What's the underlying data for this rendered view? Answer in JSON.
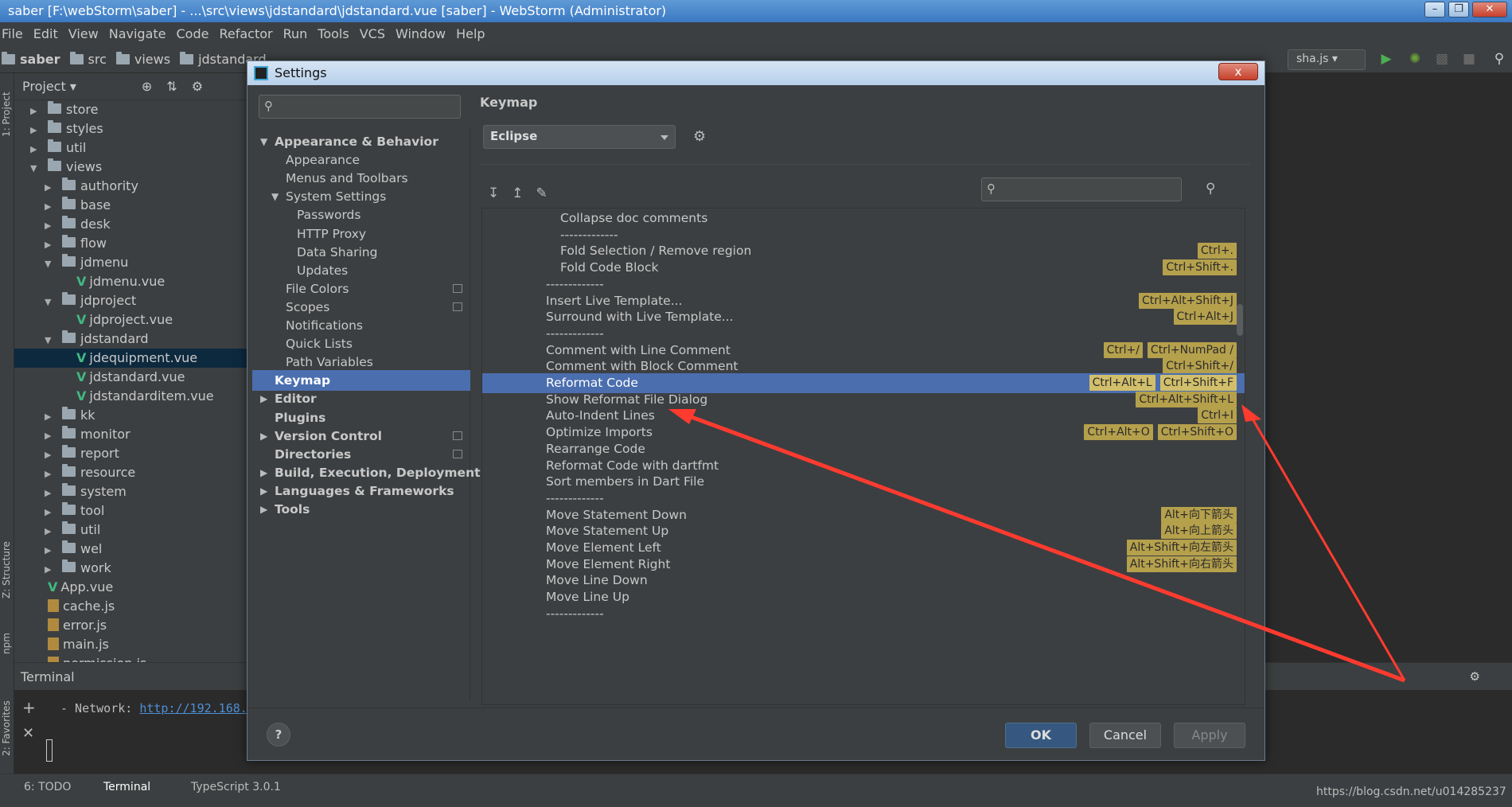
{
  "window": {
    "title": "saber [F:\\webStorm\\saber] - ...\\src\\views\\jdstandard\\jdstandard.vue [saber] - WebStorm (Administrator)"
  },
  "menu": [
    "File",
    "Edit",
    "View",
    "Navigate",
    "Code",
    "Refactor",
    "Run",
    "Tools",
    "VCS",
    "Window",
    "Help"
  ],
  "breadcrumbs": [
    "saber",
    "src",
    "views",
    "jdstandard"
  ],
  "run_config": "sha.js",
  "project": {
    "title": "Project",
    "tree": [
      {
        "label": "store",
        "type": "folder",
        "depth": 1,
        "collapsed": true
      },
      {
        "label": "styles",
        "type": "folder",
        "depth": 1,
        "collapsed": true
      },
      {
        "label": "util",
        "type": "folder",
        "depth": 1,
        "collapsed": true
      },
      {
        "label": "views",
        "type": "folder",
        "depth": 1,
        "collapsed": false
      },
      {
        "label": "authority",
        "type": "folder",
        "depth": 2,
        "collapsed": true
      },
      {
        "label": "base",
        "type": "folder",
        "depth": 2,
        "collapsed": true
      },
      {
        "label": "desk",
        "type": "folder",
        "depth": 2,
        "collapsed": true
      },
      {
        "label": "flow",
        "type": "folder",
        "depth": 2,
        "collapsed": true
      },
      {
        "label": "jdmenu",
        "type": "folder",
        "depth": 2,
        "collapsed": false
      },
      {
        "label": "jdmenu.vue",
        "type": "vue",
        "depth": 3
      },
      {
        "label": "jdproject",
        "type": "folder",
        "depth": 2,
        "collapsed": false
      },
      {
        "label": "jdproject.vue",
        "type": "vue",
        "depth": 3
      },
      {
        "label": "jdstandard",
        "type": "folder",
        "depth": 2,
        "collapsed": false
      },
      {
        "label": "jdequipment.vue",
        "type": "vue",
        "depth": 3,
        "selected": true
      },
      {
        "label": "jdstandard.vue",
        "type": "vue",
        "depth": 3
      },
      {
        "label": "jdstandarditem.vue",
        "type": "vue",
        "depth": 3
      },
      {
        "label": "kk",
        "type": "folder",
        "depth": 2,
        "collapsed": true
      },
      {
        "label": "monitor",
        "type": "folder",
        "depth": 2,
        "collapsed": true
      },
      {
        "label": "report",
        "type": "folder",
        "depth": 2,
        "collapsed": true
      },
      {
        "label": "resource",
        "type": "folder",
        "depth": 2,
        "collapsed": true
      },
      {
        "label": "system",
        "type": "folder",
        "depth": 2,
        "collapsed": true
      },
      {
        "label": "tool",
        "type": "folder",
        "depth": 2,
        "collapsed": true
      },
      {
        "label": "util",
        "type": "folder",
        "depth": 2,
        "collapsed": true
      },
      {
        "label": "wel",
        "type": "folder",
        "depth": 2,
        "collapsed": true
      },
      {
        "label": "work",
        "type": "folder",
        "depth": 2,
        "collapsed": true
      },
      {
        "label": "App.vue",
        "type": "vue",
        "depth": 1
      },
      {
        "label": "cache.js",
        "type": "js",
        "depth": 1
      },
      {
        "label": "error.js",
        "type": "js",
        "depth": 1
      },
      {
        "label": "main.js",
        "type": "js",
        "depth": 1
      },
      {
        "label": "permission.js",
        "type": "js",
        "depth": 1
      }
    ]
  },
  "side_tabs": {
    "project": "1: Project",
    "structure": "Z: Structure",
    "npm": "npm",
    "favorites": "2: Favorites"
  },
  "terminal": {
    "title": "Terminal",
    "line_prefix": "- Network: ",
    "link": "http://192.168."
  },
  "status": {
    "todo": "6: TODO",
    "terminal": "Terminal",
    "typescript": "TypeScript 3.0.1",
    "url": "https://blog.csdn.net/u014285237"
  },
  "settings": {
    "title": "Settings",
    "close": "x",
    "nav": [
      {
        "label": "Appearance & Behavior",
        "bold": true,
        "indent": 0,
        "expand": "down"
      },
      {
        "label": "Appearance",
        "indent": 1
      },
      {
        "label": "Menus and Toolbars",
        "indent": 1
      },
      {
        "label": "System Settings",
        "indent": 1,
        "expand": "down"
      },
      {
        "label": "Passwords",
        "indent": 2
      },
      {
        "label": "HTTP Proxy",
        "indent": 2
      },
      {
        "label": "Data Sharing",
        "indent": 2
      },
      {
        "label": "Updates",
        "indent": 2
      },
      {
        "label": "File Colors",
        "indent": 1,
        "copy": true
      },
      {
        "label": "Scopes",
        "indent": 1,
        "copy": true
      },
      {
        "label": "Notifications",
        "indent": 1
      },
      {
        "label": "Quick Lists",
        "indent": 1
      },
      {
        "label": "Path Variables",
        "indent": 1
      },
      {
        "label": "Keymap",
        "bold": true,
        "indent": 0,
        "selected": true
      },
      {
        "label": "Editor",
        "bold": true,
        "indent": 0,
        "expand": "right"
      },
      {
        "label": "Plugins",
        "bold": true,
        "indent": 0
      },
      {
        "label": "Version Control",
        "bold": true,
        "indent": 0,
        "expand": "right",
        "copy": true
      },
      {
        "label": "Directories",
        "bold": true,
        "indent": 0,
        "copy": true
      },
      {
        "label": "Build, Execution, Deployment",
        "bold": true,
        "indent": 0,
        "expand": "right"
      },
      {
        "label": "Languages & Frameworks",
        "bold": true,
        "indent": 0,
        "expand": "right"
      },
      {
        "label": "Tools",
        "bold": true,
        "indent": 0,
        "expand": "right"
      }
    ],
    "keymap": {
      "heading": "Keymap",
      "scheme": "Eclipse",
      "rows": [
        {
          "label": "Collapse doc comments",
          "indent": 2,
          "shortcuts": []
        },
        {
          "label": "-------------",
          "indent": 2,
          "shortcuts": []
        },
        {
          "label": "Fold Selection / Remove region",
          "indent": 2,
          "shortcuts": [
            "Ctrl+."
          ]
        },
        {
          "label": "Fold Code Block",
          "indent": 2,
          "shortcuts": [
            "Ctrl+Shift+."
          ]
        },
        {
          "label": "-------------",
          "indent": 1,
          "shortcuts": []
        },
        {
          "label": "Insert Live Template...",
          "indent": 1,
          "shortcuts": [
            "Ctrl+Alt+Shift+J"
          ]
        },
        {
          "label": "Surround with Live Template...",
          "indent": 1,
          "shortcuts": [
            "Ctrl+Alt+J"
          ]
        },
        {
          "label": "-------------",
          "indent": 1,
          "shortcuts": []
        },
        {
          "label": "Comment with Line Comment",
          "indent": 1,
          "shortcuts": [
            "Ctrl+/",
            "Ctrl+NumPad /"
          ]
        },
        {
          "label": "Comment with Block Comment",
          "indent": 1,
          "shortcuts": [
            "Ctrl+Shift+/"
          ]
        },
        {
          "label": "Reformat Code",
          "indent": 1,
          "shortcuts": [
            "Ctrl+Alt+L",
            "Ctrl+Shift+F"
          ],
          "selected": true
        },
        {
          "label": "Show Reformat File Dialog",
          "indent": 1,
          "shortcuts": [
            "Ctrl+Alt+Shift+L"
          ]
        },
        {
          "label": "Auto-Indent Lines",
          "indent": 1,
          "shortcuts": [
            "Ctrl+I"
          ]
        },
        {
          "label": "Optimize Imports",
          "indent": 1,
          "shortcuts": [
            "Ctrl+Alt+O",
            "Ctrl+Shift+O"
          ]
        },
        {
          "label": "Rearrange Code",
          "indent": 1,
          "shortcuts": []
        },
        {
          "label": "Reformat Code with dartfmt",
          "indent": 1,
          "shortcuts": []
        },
        {
          "label": "Sort members in Dart File",
          "indent": 1,
          "shortcuts": []
        },
        {
          "label": "-------------",
          "indent": 1,
          "shortcuts": []
        },
        {
          "label": "Move Statement Down",
          "indent": 1,
          "shortcuts": [
            "Alt+向下箭头"
          ]
        },
        {
          "label": "Move Statement Up",
          "indent": 1,
          "shortcuts": [
            "Alt+向上箭头"
          ]
        },
        {
          "label": "Move Element Left",
          "indent": 1,
          "shortcuts": [
            "Alt+Shift+向左箭头"
          ]
        },
        {
          "label": "Move Element Right",
          "indent": 1,
          "shortcuts": [
            "Alt+Shift+向右箭头"
          ]
        },
        {
          "label": "Move Line Down",
          "indent": 1,
          "shortcuts": []
        },
        {
          "label": "Move Line Up",
          "indent": 1,
          "shortcuts": []
        },
        {
          "label": "-------------",
          "indent": 1,
          "shortcuts": []
        }
      ]
    },
    "buttons": {
      "ok": "OK",
      "cancel": "Cancel",
      "apply": "Apply",
      "help": "?"
    }
  },
  "colors": {
    "selection": "#4b6eaf",
    "shortcut_bg": "#b5a04c",
    "annotation_arrow": "#ff3b30"
  }
}
